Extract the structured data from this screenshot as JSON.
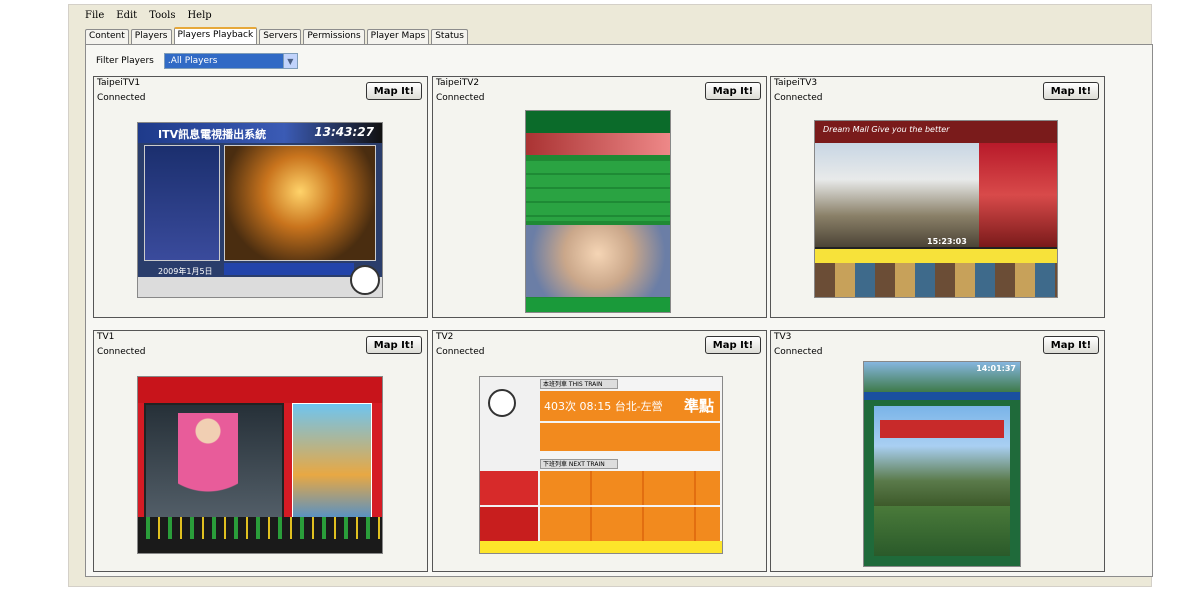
{
  "menu": [
    "File",
    "Edit",
    "Tools",
    "Help"
  ],
  "tabs": [
    {
      "label": "Content",
      "active": false
    },
    {
      "label": "Players",
      "active": false
    },
    {
      "label": "Players Playback",
      "active": true
    },
    {
      "label": "Servers",
      "active": false
    },
    {
      "label": "Permissions",
      "active": false
    },
    {
      "label": "Player Maps",
      "active": false
    },
    {
      "label": "Status",
      "active": false
    }
  ],
  "filter": {
    "label": "Filter Players",
    "selected": ".All Players"
  },
  "map_button_label": "Map It!",
  "players": [
    {
      "name": "TaipeiTV1",
      "status": "Connected"
    },
    {
      "name": "TaipeiTV2",
      "status": "Connected"
    },
    {
      "name": "TaipeiTV3",
      "status": "Connected"
    },
    {
      "name": "TV1",
      "status": "Connected"
    },
    {
      "name": "TV2",
      "status": "Connected"
    },
    {
      "name": "TV3",
      "status": "Connected"
    }
  ],
  "thumbnails": {
    "tv1": {
      "title": "ITV訊息電視播出系統",
      "clock": "13:43:27",
      "date": "2009年1月5日"
    },
    "tv3": {
      "header": "Dream Mall   Give you the better",
      "time": "15:23:03"
    },
    "tv5": {
      "this_train": "本班列車 THIS TRAIN",
      "train_info": "403次 08:15 台北-左營",
      "ontime": "準點",
      "next_train": "下班列車 NEXT TRAIN"
    },
    "tv6": {
      "time": "14:01:37"
    }
  },
  "colors": {
    "accent_tab": "#e6a83a",
    "select_highlight": "#316ac5"
  }
}
